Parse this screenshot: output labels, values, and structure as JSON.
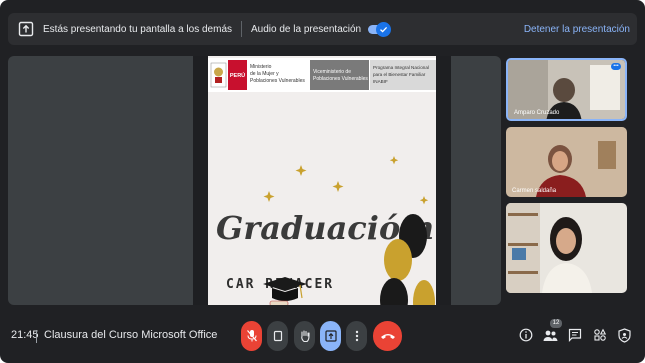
{
  "banner": {
    "presenting_text": "Estás presentando tu pantalla a los demás",
    "audio_label": "Audio de la presentación",
    "audio_enabled": true,
    "stop_label": "Detener la presentación"
  },
  "slide": {
    "country": "PERÚ",
    "ministry": [
      "Ministerio",
      "de la Mujer y",
      "Poblaciones Vulnerables"
    ],
    "vice_ministry": [
      "Viceministerio de",
      "Poblaciones Vulnerables"
    ],
    "program": [
      "Programa Integral Nacional",
      "para el Bienestar Familiar",
      "INABIF"
    ],
    "title": "Graduaciόm",
    "subtitle": "CAR RENACER"
  },
  "participants": [
    {
      "name": "Amparo Cruzado",
      "speaking": true
    },
    {
      "name": "Carmen saldaña"
    },
    {
      "name": ""
    }
  ],
  "bottom_bar": {
    "time": "21:45",
    "meeting_name": "Clausura del Curso Microsoft Office",
    "participant_count": "12"
  },
  "icons": {
    "share": "present-screen-icon",
    "mic": "mic-off-icon",
    "camera": "camera-off-icon",
    "hand": "raise-hand-icon",
    "present": "present-now-icon",
    "more": "more-vert-icon",
    "end": "end-call-icon",
    "info": "info-icon",
    "people": "people-icon",
    "chat": "chat-icon",
    "activities": "activities-icon",
    "host": "host-controls-icon"
  },
  "colors": {
    "background": "#202124",
    "accent": "#8ab4f8",
    "danger": "#ea4335"
  }
}
